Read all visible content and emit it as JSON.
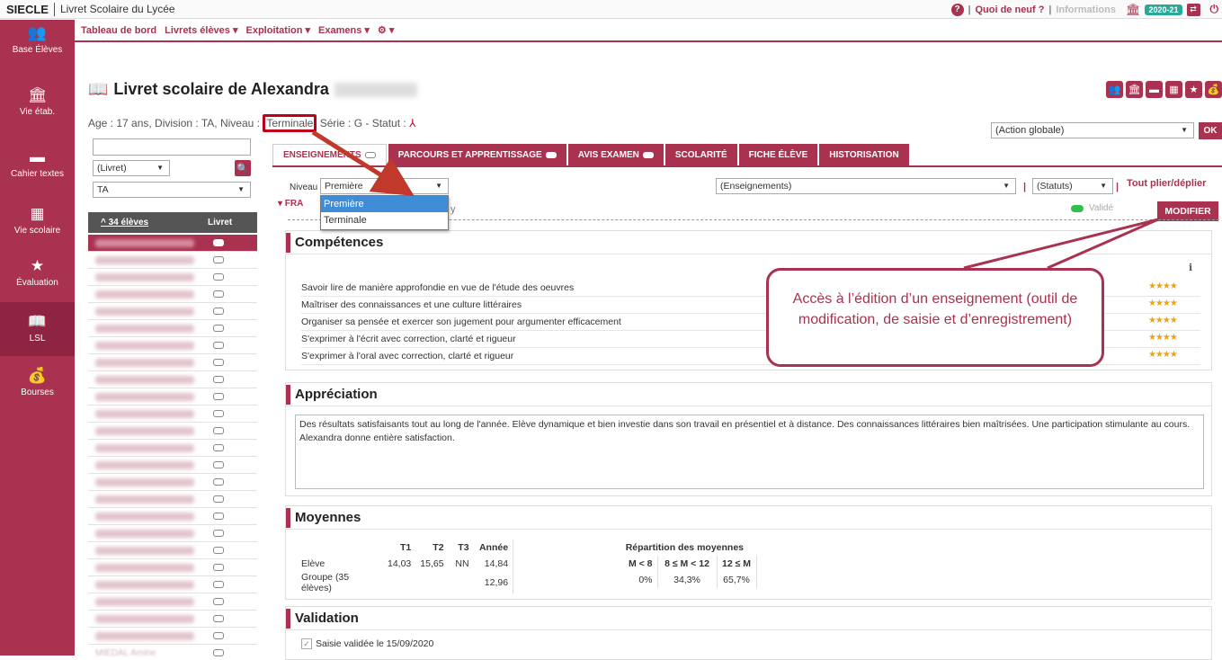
{
  "header": {
    "app_name": "SIECLE",
    "subtitle": "Livret Scolaire du Lycée",
    "help_icon": "?",
    "news": "Quoi de neuf ?",
    "info": "Informations",
    "year": "2020-21",
    "sep": "|"
  },
  "sidebar": [
    {
      "label": "Base Élèves",
      "icon": "users-icon",
      "glyph": "👥"
    },
    {
      "label": "Vie étab.",
      "icon": "building-icon",
      "glyph": "🏛"
    },
    {
      "label": "Cahier textes",
      "icon": "book-icon",
      "glyph": "▬"
    },
    {
      "label": "Vie scolaire",
      "icon": "calendar-icon",
      "glyph": "▦"
    },
    {
      "label": "Évaluation",
      "icon": "star-icon",
      "glyph": "★"
    },
    {
      "label": "LSL",
      "icon": "open-book-icon",
      "glyph": "📖"
    },
    {
      "label": "Bourses",
      "icon": "bag-icon",
      "glyph": "💰"
    }
  ],
  "menu": {
    "dashboard": "Tableau de bord",
    "livrets": "Livrets élèves ▾",
    "exploitation": "Exploitation ▾",
    "examens": "Examens ▾",
    "settings": "⚙ ▾"
  },
  "page": {
    "title": "Livret scolaire de Alexandra",
    "info_prefix": "Age : 17 ans, Division : TA, Niveau : ",
    "info_level": "Terminale",
    "info_suffix": " Série : G - Statut : ",
    "pdf": "⅄"
  },
  "actions": {
    "global": "(Action globale)",
    "ok": "OK"
  },
  "left": {
    "livret_select": "(Livret)",
    "class_select": "TA",
    "col_students": "^ 34 élèves",
    "col_livret": "Livret",
    "last_student": "MIEDAL Amine"
  },
  "tabs": [
    {
      "label": "ENSEIGNEMENTS",
      "pill": true
    },
    {
      "label": "PARCOURS ET APPRENTISSAGE",
      "pill": true
    },
    {
      "label": "AVIS EXAMEN",
      "pill": true
    },
    {
      "label": "SCOLARITÉ",
      "pill": false
    },
    {
      "label": "FICHE ÉLÈVE",
      "pill": false
    },
    {
      "label": "HISTORISATION",
      "pill": false
    }
  ],
  "filters": {
    "niveau_label": "Niveau",
    "niveau_value": "Première",
    "niveau_options": [
      "Première",
      "Terminale"
    ],
    "enseignements": "(Enseignements)",
    "statuts": "(Statuts)",
    "toggle_all": "Tout plier/déplier"
  },
  "subject": {
    "code": "▾ FRA",
    "suffix": "y",
    "valide": "Validé",
    "modify": "MODIFIER"
  },
  "competences": {
    "heading": "Compétences",
    "items": [
      "Savoir lire de manière approfondie en vue de l'étude des oeuvres",
      "Maîtriser des connaissances et une culture littéraires",
      "Organiser sa pensée et exercer son jugement pour argumenter efficacement",
      "S'exprimer à l'écrit avec correction, clarté et rigueur",
      "S'exprimer à l'oral avec correction, clarté et rigueur"
    ],
    "stars": "★★★★"
  },
  "appreciation": {
    "heading": "Appréciation",
    "text": "Des résultats satisfaisants tout au long de l'année. Elève dynamique et bien investie dans son travail en présentiel et à distance. Des connaissances littéraires bien maîtrisées. Une participation stimulante au cours. Alexandra donne entière satisfaction."
  },
  "moyennes": {
    "heading": "Moyennes",
    "headers": [
      "T1",
      "T2",
      "T3",
      "Année"
    ],
    "rows": [
      {
        "label": "Elève",
        "values": [
          "14,03",
          "15,65",
          "NN",
          "14,84"
        ]
      },
      {
        "label": "Groupe (35 élèves)",
        "values": [
          "",
          "",
          "",
          "12,96"
        ]
      }
    ],
    "repartition_title": "Répartition des moyennes",
    "rep_headers": [
      "M < 8",
      "8 ≤ M < 12",
      "12 ≤ M"
    ],
    "rep_values": [
      "0%",
      "34,3%",
      "65,7%"
    ]
  },
  "validation": {
    "heading": "Validation",
    "text": "Saisie validée le 15/09/2020"
  },
  "annotation": {
    "text": "Accès à l’édition d’un enseignement (outil de modification, de saisie et d’enregistrement)"
  }
}
